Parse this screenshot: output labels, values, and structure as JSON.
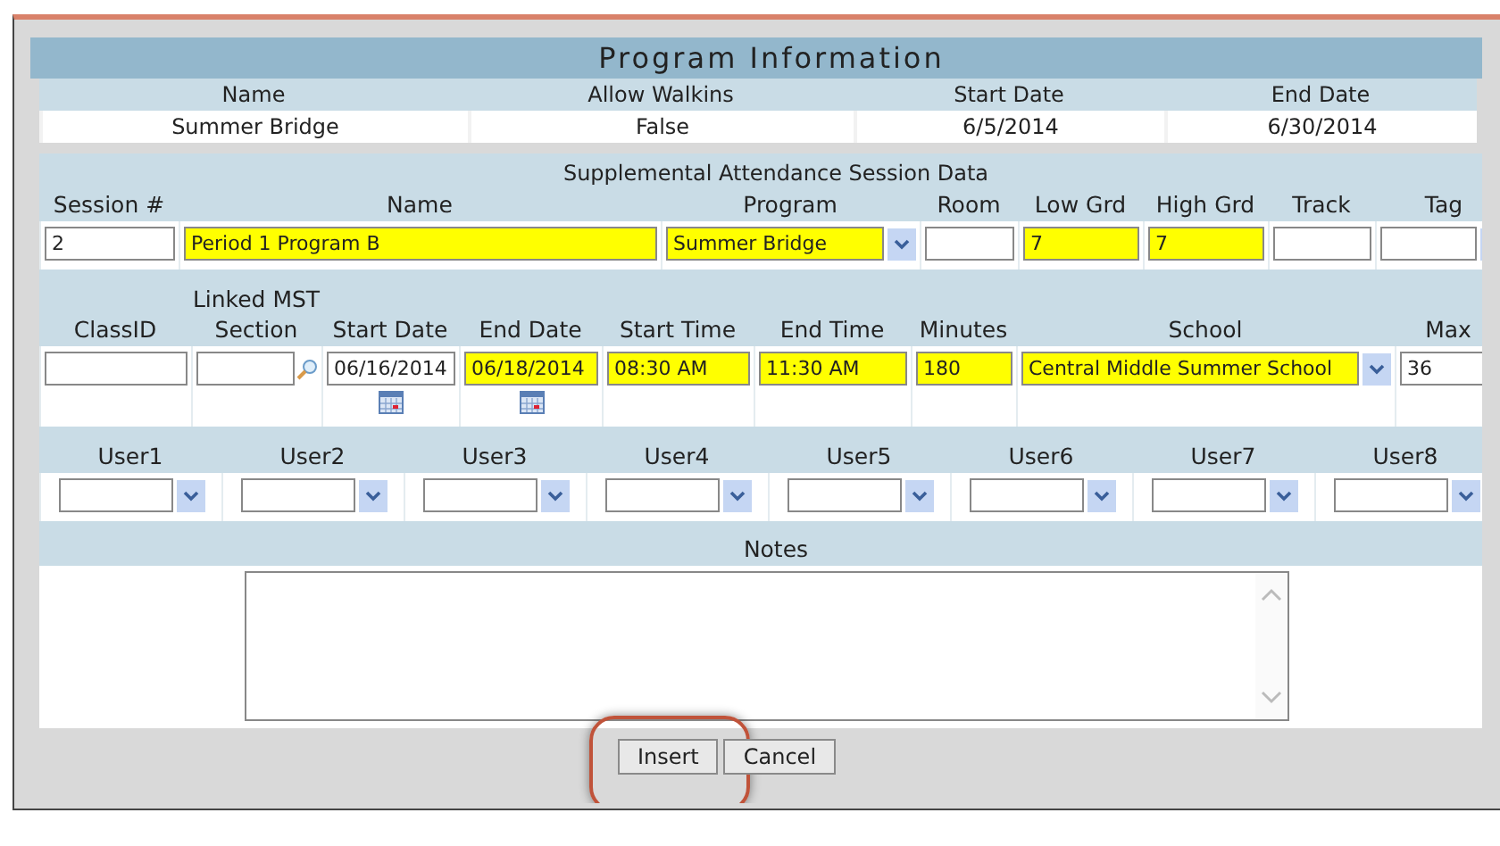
{
  "program_info": {
    "title": "Program Information",
    "columns": [
      "Name",
      "Allow Walkins",
      "Start Date",
      "End Date"
    ],
    "values": [
      "Summer Bridge",
      "False",
      "6/5/2014",
      "6/30/2014"
    ]
  },
  "session": {
    "title": "Supplemental Attendance Session Data",
    "row1": [
      {
        "label": "Session #",
        "kind": "text",
        "value": "2",
        "required": false
      },
      {
        "label": "Name",
        "kind": "text",
        "value": "Period 1 Program B",
        "required": true
      },
      {
        "label": "Program",
        "kind": "select",
        "value": "Summer Bridge",
        "required": true
      },
      {
        "label": "Room",
        "kind": "text",
        "required": false
      },
      {
        "label": "Low Grd",
        "kind": "text",
        "value": "7",
        "required": true
      },
      {
        "label": "High Grd",
        "kind": "text",
        "value": "7",
        "required": true
      },
      {
        "label": "Track",
        "kind": "text",
        "required": false
      },
      {
        "label": "Tag",
        "kind": "select",
        "required": false
      }
    ],
    "row2": [
      {
        "label": "ClassID",
        "kind": "text",
        "required": false
      },
      {
        "label": "Linked MST Section",
        "kind": "lookup",
        "required": false
      },
      {
        "label": "Start Date",
        "kind": "date",
        "value": "06/16/2014",
        "required": false
      },
      {
        "label": "End Date",
        "kind": "date",
        "value": "06/18/2014",
        "required": true
      },
      {
        "label": "Start Time",
        "kind": "text",
        "value": "08:30 AM",
        "required": true
      },
      {
        "label": "End Time",
        "kind": "text",
        "value": "11:30 AM",
        "required": true
      },
      {
        "label": "Minutes",
        "kind": "text",
        "value": "180",
        "required": true
      },
      {
        "label": "School",
        "kind": "select",
        "value": "Central Middle Summer School",
        "required": true
      },
      {
        "label": "Max",
        "kind": "text",
        "value": "36",
        "required": false
      }
    ],
    "users": [
      {
        "label": "User1",
        "kind": "select",
        "required": false
      },
      {
        "label": "User2",
        "kind": "select",
        "required": false
      },
      {
        "label": "User3",
        "kind": "select",
        "required": false
      },
      {
        "label": "User4",
        "kind": "select",
        "required": false
      },
      {
        "label": "User5",
        "kind": "select",
        "required": false
      },
      {
        "label": "User6",
        "kind": "select",
        "required": false
      },
      {
        "label": "User7",
        "kind": "select",
        "required": false
      },
      {
        "label": "User8",
        "kind": "select",
        "required": false
      }
    ],
    "notes": {
      "label": "Notes"
    }
  },
  "buttons": [
    {
      "label": "Insert",
      "highlighted": true
    },
    {
      "label": "Cancel",
      "highlighted": false
    }
  ]
}
